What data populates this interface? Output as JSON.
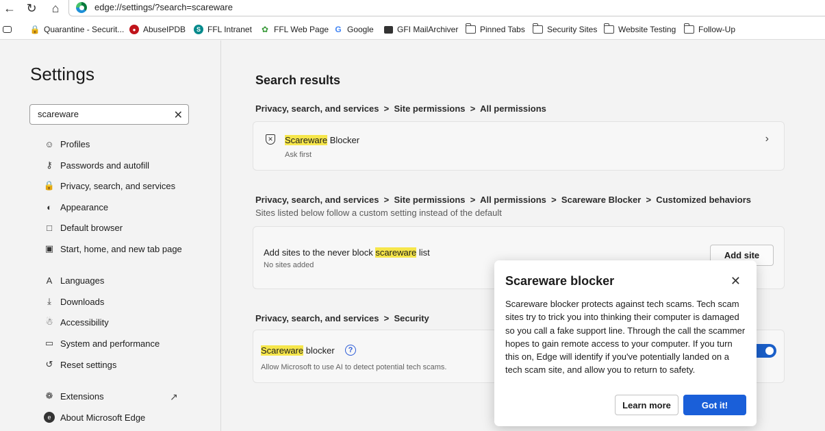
{
  "address_bar": {
    "url": "edge://settings/?search=scareware"
  },
  "favorites": [
    {
      "label": "Quarantine - Securit...",
      "icon": "lock-icon"
    },
    {
      "label": "AbuseIPDB",
      "icon": "abuseipdb-icon"
    },
    {
      "label": "FFL Intranet",
      "icon": "sharepoint-icon"
    },
    {
      "label": "FFL Web Page",
      "icon": "leaf-icon"
    },
    {
      "label": "Google",
      "icon": "google-icon"
    },
    {
      "label": "GFI MailArchiver",
      "icon": "gfi-icon"
    },
    {
      "label": "Pinned Tabs",
      "icon": "folder-icon"
    },
    {
      "label": "Security Sites",
      "icon": "folder-icon"
    },
    {
      "label": "Website Testing",
      "icon": "folder-icon"
    },
    {
      "label": "Follow-Up",
      "icon": "folder-icon"
    }
  ],
  "sidebar": {
    "title": "Settings",
    "search_value": "scareware",
    "items": [
      {
        "label": "Profiles",
        "icon": "profile-icon"
      },
      {
        "label": "Passwords and autofill",
        "icon": "key-icon"
      },
      {
        "label": "Privacy, search, and services",
        "icon": "lock-icon"
      },
      {
        "label": "Appearance",
        "icon": "palette-icon"
      },
      {
        "label": "Default browser",
        "icon": "browser-icon"
      },
      {
        "label": "Start, home, and new tab page",
        "icon": "home-tab-icon"
      },
      {
        "label": "Languages",
        "icon": "languages-icon"
      },
      {
        "label": "Downloads",
        "icon": "download-icon"
      },
      {
        "label": "Accessibility",
        "icon": "accessibility-icon"
      },
      {
        "label": "System and performance",
        "icon": "laptop-icon"
      },
      {
        "label": "Reset settings",
        "icon": "reset-icon"
      },
      {
        "label": "Extensions",
        "icon": "puzzle-icon"
      },
      {
        "label": "About Microsoft Edge",
        "icon": "edge-icon"
      }
    ]
  },
  "main": {
    "heading": "Search results",
    "section1": {
      "crumb": "Privacy, search, and services  >  Site permissions  >  All permissions",
      "item_hl": "Scareware",
      "item_rest": " Blocker",
      "item_sub": "Ask first"
    },
    "section2": {
      "crumb": "Privacy, search, and services  >  Site permissions  >  All permissions  >  Scareware Blocker  >  Customized behaviors",
      "subcrumb": "Sites listed below follow a custom setting instead of the default",
      "item_pre": "Add sites to the never block ",
      "item_hl": "scareware",
      "item_post": " list",
      "item_sub": "No sites added",
      "button": "Add site"
    },
    "section3": {
      "crumb": "Privacy, search, and services  >  Security",
      "item_hl": "Scareware",
      "item_rest": " blocker",
      "item_sub": "Allow Microsoft to use AI to detect potential tech scams.",
      "toggle_on": true
    }
  },
  "popup": {
    "title": "Scareware blocker",
    "body": "Scareware blocker protects against tech scams. Tech scam sites try to trick you into thinking their computer is damaged so you call a fake support line. Through the call the scammer hopes to gain remote access to your computer. If you turn this on, Edge will identify if you've potentially landed on a tech scam site, and allow you to return to safety.",
    "learn_more": "Learn more",
    "got_it": "Got it!"
  },
  "colors": {
    "accent": "#1a5fd9",
    "highlight": "#f6e64b"
  }
}
